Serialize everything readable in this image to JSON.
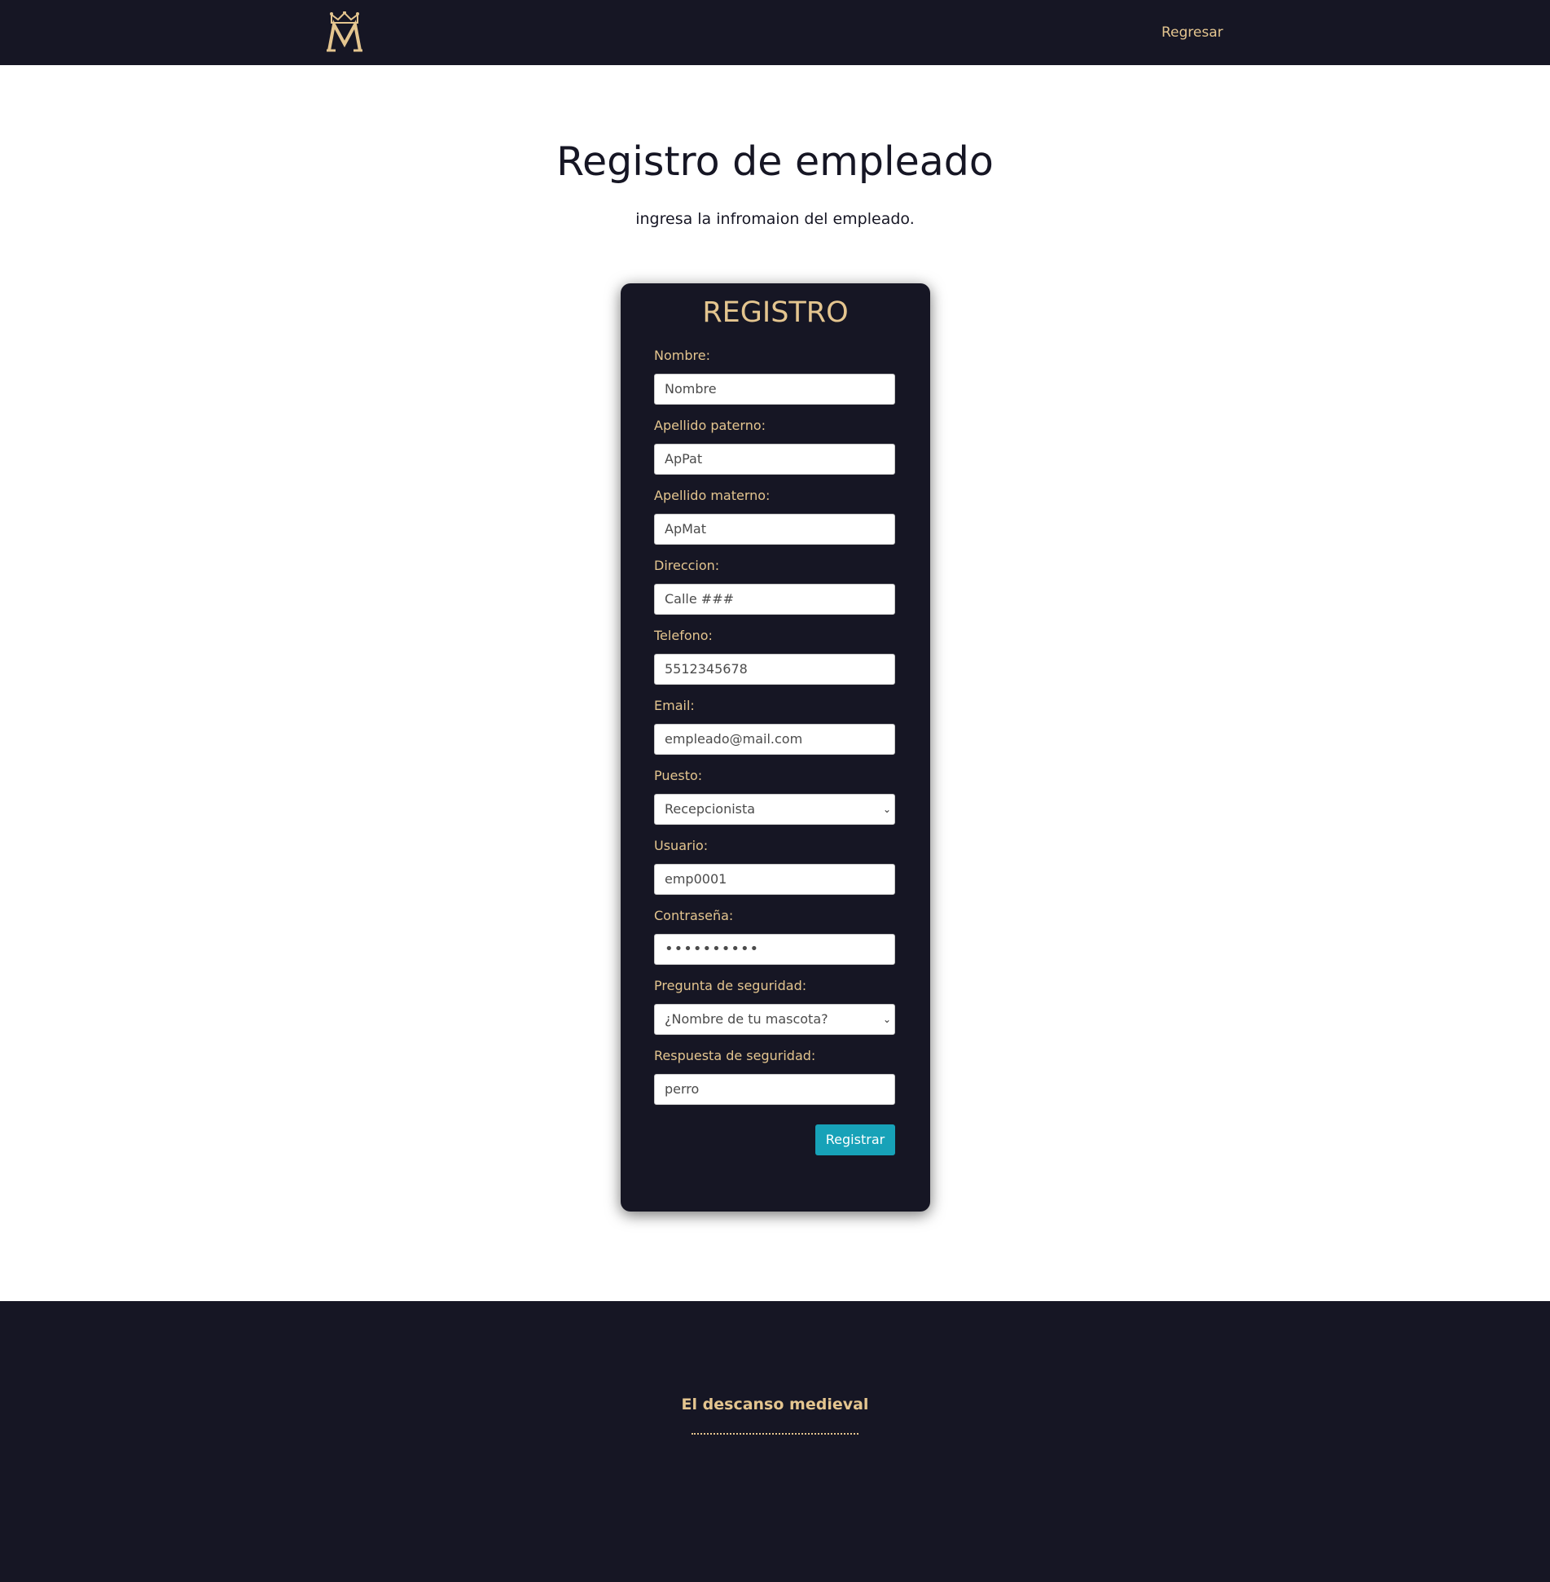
{
  "header": {
    "logo_letter": "M",
    "nav_link": "Regresar"
  },
  "main": {
    "title": "Registro de empleado",
    "subtitle": "ingresa la infromaion del empleado."
  },
  "form": {
    "title": "REGISTRO",
    "fields": [
      {
        "label": "Nombre:",
        "value": "Nombre"
      },
      {
        "label": "Apellido paterno:",
        "value": "ApPat"
      },
      {
        "label": "Apellido materno:",
        "value": "ApMat"
      },
      {
        "label": "Direccion:",
        "value": "Calle ###"
      },
      {
        "label": "Telefono:",
        "value": "5512345678"
      },
      {
        "label": "Email:",
        "value": "empleado@mail.com"
      },
      {
        "label": "Puesto:",
        "value": "Recepcionista"
      },
      {
        "label": "Usuario:",
        "value": "emp0001"
      },
      {
        "label": "Contraseña:",
        "value": "••••••••••"
      },
      {
        "label": "Pregunta de seguridad:",
        "value": "¿Nombre de tu mascota?"
      },
      {
        "label": "Respuesta de seguridad:",
        "value": "perro"
      }
    ],
    "submit_label": "Registrar"
  },
  "footer": {
    "brand": "El descanso medieval"
  },
  "colors": {
    "dark": "#161624",
    "gold": "#e4c58f",
    "accent": "#17a2b8"
  }
}
